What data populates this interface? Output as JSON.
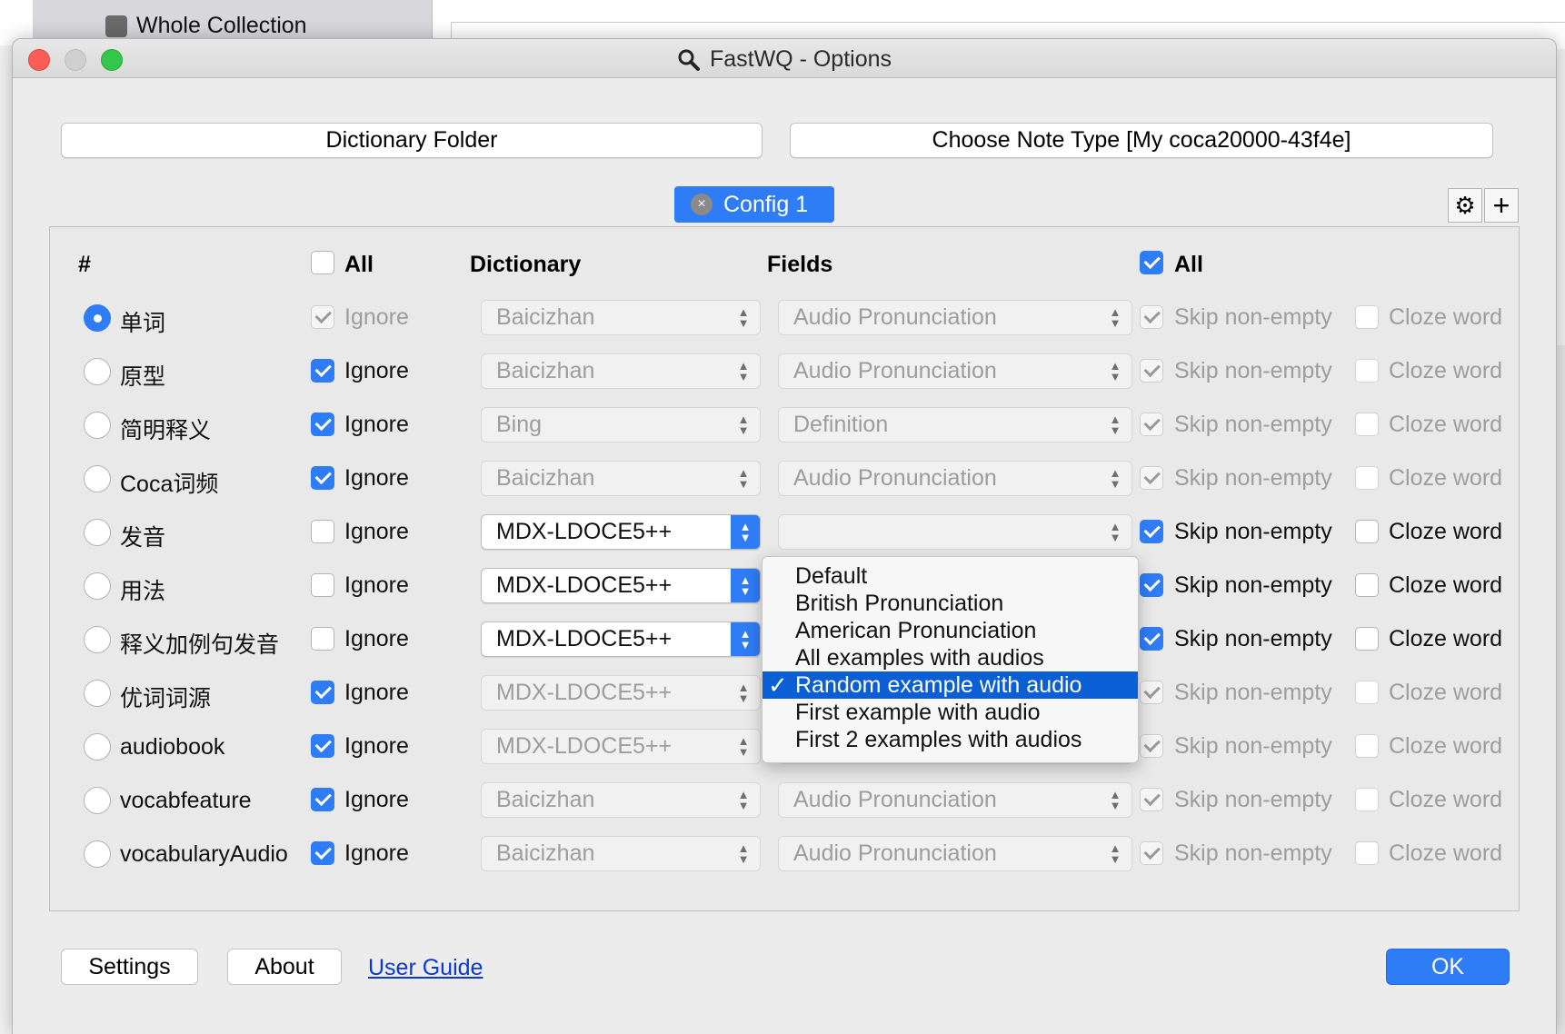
{
  "background": {
    "sidebar_item": "Whole Collection"
  },
  "window": {
    "title": "FastWQ - Options"
  },
  "top_buttons": {
    "dictionary_folder": "Dictionary Folder",
    "choose_note_type": "Choose Note Type [My coca20000-43f4e]"
  },
  "config_tab": {
    "label": "Config 1",
    "close_glyph": "×"
  },
  "toolbar": {
    "gear_icon": "⚙",
    "plus_icon": "+"
  },
  "headers": {
    "hash": "#",
    "all_ignore": "All",
    "dictionary": "Dictionary",
    "fields": "Fields",
    "all_skip": "All",
    "all_skip_checked": true
  },
  "labels": {
    "ignore": "Ignore",
    "skip": "Skip non-empty",
    "cloze": "Cloze word"
  },
  "rows": [
    {
      "name": "单词",
      "selected": true,
      "ignore": true,
      "ignore_disabled": true,
      "dictionary": "Baicizhan",
      "field": "Audio Pronunciation",
      "active": false,
      "skip": true,
      "cloze": false
    },
    {
      "name": "原型",
      "selected": false,
      "ignore": true,
      "ignore_disabled": false,
      "dictionary": "Baicizhan",
      "field": "Audio Pronunciation",
      "active": false,
      "skip": true,
      "cloze": false
    },
    {
      "name": "简明释义",
      "selected": false,
      "ignore": true,
      "ignore_disabled": false,
      "dictionary": "Bing",
      "field": "Definition",
      "active": false,
      "skip": true,
      "cloze": false
    },
    {
      "name": "Coca词频",
      "selected": false,
      "ignore": true,
      "ignore_disabled": false,
      "dictionary": "Baicizhan",
      "field": "Audio Pronunciation",
      "active": false,
      "skip": true,
      "cloze": false
    },
    {
      "name": "发音",
      "selected": false,
      "ignore": false,
      "ignore_disabled": false,
      "dictionary": "MDX-LDOCE5++",
      "field": "",
      "active": true,
      "skip": true,
      "cloze": false
    },
    {
      "name": "用法",
      "selected": false,
      "ignore": false,
      "ignore_disabled": false,
      "dictionary": "MDX-LDOCE5++",
      "field": "",
      "active": true,
      "skip": true,
      "cloze": false
    },
    {
      "name": "释义加例句发音",
      "selected": false,
      "ignore": false,
      "ignore_disabled": false,
      "dictionary": "MDX-LDOCE5++",
      "field": "",
      "active": true,
      "skip": true,
      "cloze": false
    },
    {
      "name": "优词词源",
      "selected": false,
      "ignore": true,
      "ignore_disabled": false,
      "dictionary": "MDX-LDOCE5++",
      "field": "",
      "active": false,
      "skip": true,
      "cloze": false
    },
    {
      "name": "audiobook",
      "selected": false,
      "ignore": true,
      "ignore_disabled": false,
      "dictionary": "MDX-LDOCE5++",
      "field": "First 2 examples with audios",
      "active": false,
      "skip": true,
      "cloze": false
    },
    {
      "name": "vocabfeature",
      "selected": false,
      "ignore": true,
      "ignore_disabled": false,
      "dictionary": "Baicizhan",
      "field": "Audio Pronunciation",
      "active": false,
      "skip": true,
      "cloze": false
    },
    {
      "name": "vocabularyAudio",
      "selected": false,
      "ignore": true,
      "ignore_disabled": false,
      "dictionary": "Baicizhan",
      "field": "Audio Pronunciation",
      "active": false,
      "skip": true,
      "cloze": false
    }
  ],
  "dropdown": {
    "options": [
      "Default",
      "British Pronunciation",
      "American Pronunciation",
      "All examples with audios",
      "Random example with audio",
      "First example with audio",
      "First 2 examples with audios"
    ],
    "selected": "Random example with audio",
    "check_glyph": "✓"
  },
  "footer": {
    "settings": "Settings",
    "about": "About",
    "user_guide": "User Guide",
    "ok": "OK"
  },
  "colors": {
    "accent": "#2e7cf6",
    "selection": "#0a5fd6",
    "link": "#0b37d8"
  }
}
